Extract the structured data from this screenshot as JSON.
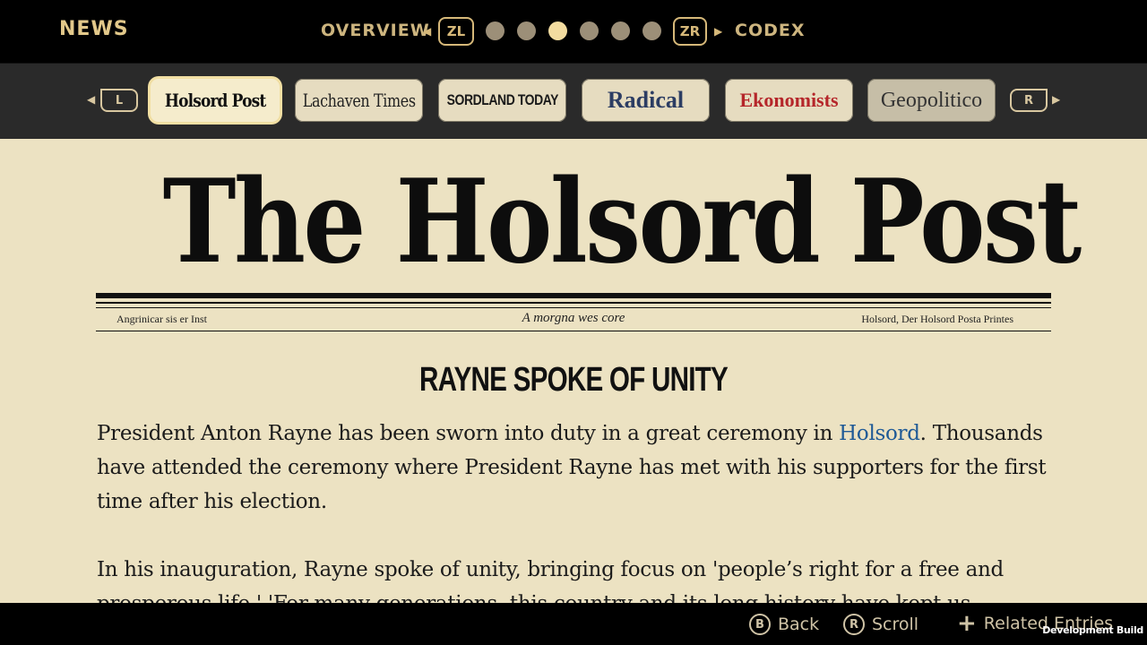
{
  "topbar": {
    "section_title": "NEWS",
    "overview_label": "OVERVIEW",
    "codex_label": "CODEX",
    "prev_button": "ZL",
    "next_button": "ZR",
    "page_dots": {
      "count": 6,
      "active_index": 2
    },
    "colors": {
      "accent": "#e2c88a",
      "dot_inactive": "#9c8f78",
      "dot_active": "#f3dca0"
    }
  },
  "tabs": {
    "prev_button": "L",
    "next_button": "R",
    "items": [
      {
        "label": "Holsord Post",
        "active": true
      },
      {
        "label": "Lachaven Times",
        "active": false
      },
      {
        "label": "SORDLAND TODAY",
        "active": false
      },
      {
        "label": "Radical",
        "active": false
      },
      {
        "label": "Ekonomists",
        "active": false
      },
      {
        "label": "Geopolitico",
        "active": false
      }
    ]
  },
  "paper": {
    "masthead": "The Holsord Post",
    "dateline_left": "Angrinicar sis er Inst",
    "dateline_center": "A morgna wes core",
    "dateline_right": "Holsord, Der Holsord Posta Printes",
    "headline": "RAYNE SPOKE OF UNITY",
    "paragraph1_before_link": "President Anton Rayne has been sworn into duty in a great ceremony in ",
    "paragraph1_link": "Holsord",
    "paragraph1_after_link": ". Thousands have attended the ceremony where President Rayne has met with his supporters for the first time after his election.",
    "paragraph2": "In his inauguration, Rayne spoke of unity, bringing focus on 'people’s right for a free and prosperous life.' 'For many generations, this country and its long history have kept us",
    "colors": {
      "paper": "#ece2c2",
      "link": "#1f5a96"
    }
  },
  "bottombar": {
    "back_glyph": "B",
    "back_label": "Back",
    "scroll_glyph": "R",
    "scroll_label": "Scroll",
    "related_glyph": "+",
    "related_label": "Related Entries",
    "build_label": "Development Build"
  }
}
